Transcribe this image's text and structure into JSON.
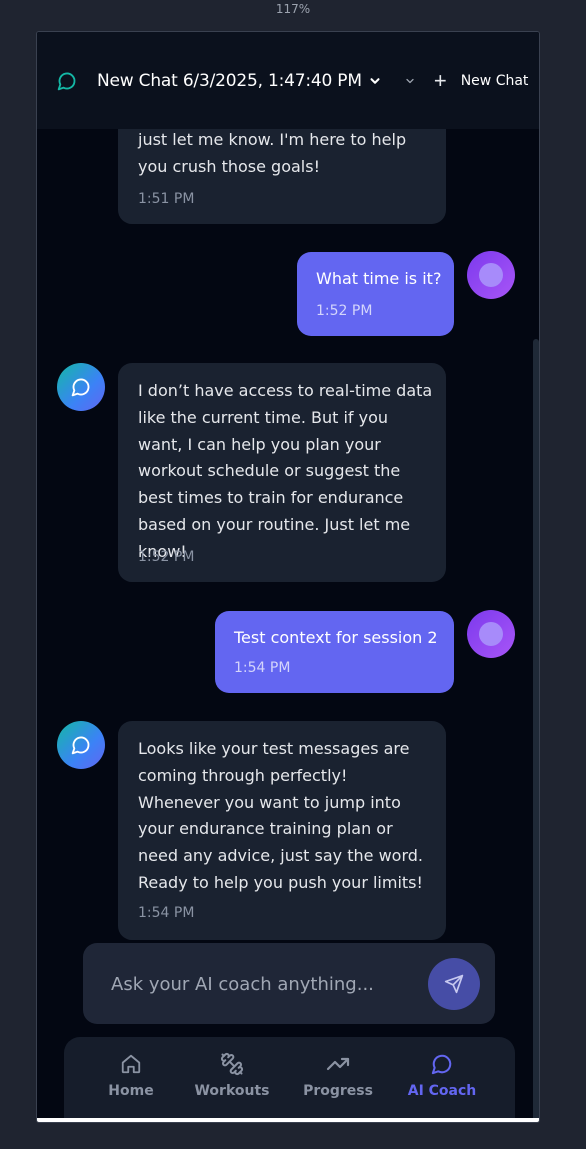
{
  "zoom": "117%",
  "header": {
    "title": "New Chat 6/3/2025, 1:47:40 PM",
    "new_chat_label": "New Chat"
  },
  "messages": [
    {
      "role": "bot",
      "text": "just let me know. I'm here to help you crush those goals!",
      "time": "1:51 PM"
    },
    {
      "role": "user",
      "text": "What time is it?",
      "time": "1:52 PM"
    },
    {
      "role": "bot",
      "text": "I don’t have access to real-time data like the current time. But if you want, I can help you plan your workout schedule or suggest the best times to train for endurance based on your routine. Just let me know!",
      "time": "1:52 PM"
    },
    {
      "role": "user",
      "text": "Test context for session 2",
      "time": "1:54 PM"
    },
    {
      "role": "bot",
      "text": "Looks like your test messages are coming through perfectly! Whenever you want to jump into your endurance training plan or need any advice, just say the word. Ready to help you push your limits!",
      "time": "1:54 PM"
    }
  ],
  "composer": {
    "placeholder": "Ask your AI coach anything..."
  },
  "nav": {
    "items": [
      {
        "label": "Home",
        "icon": "home-icon"
      },
      {
        "label": "Workouts",
        "icon": "dumbbell-icon"
      },
      {
        "label": "Progress",
        "icon": "trending-up-icon"
      },
      {
        "label": "AI Coach",
        "icon": "chat-bubble-icon",
        "active": true
      }
    ]
  },
  "colors": {
    "accent": "#6366f1",
    "background": "#030712",
    "bot_bubble": "#1a2230",
    "user_bubble": "#6366f1",
    "teal": "#14b8a6"
  }
}
